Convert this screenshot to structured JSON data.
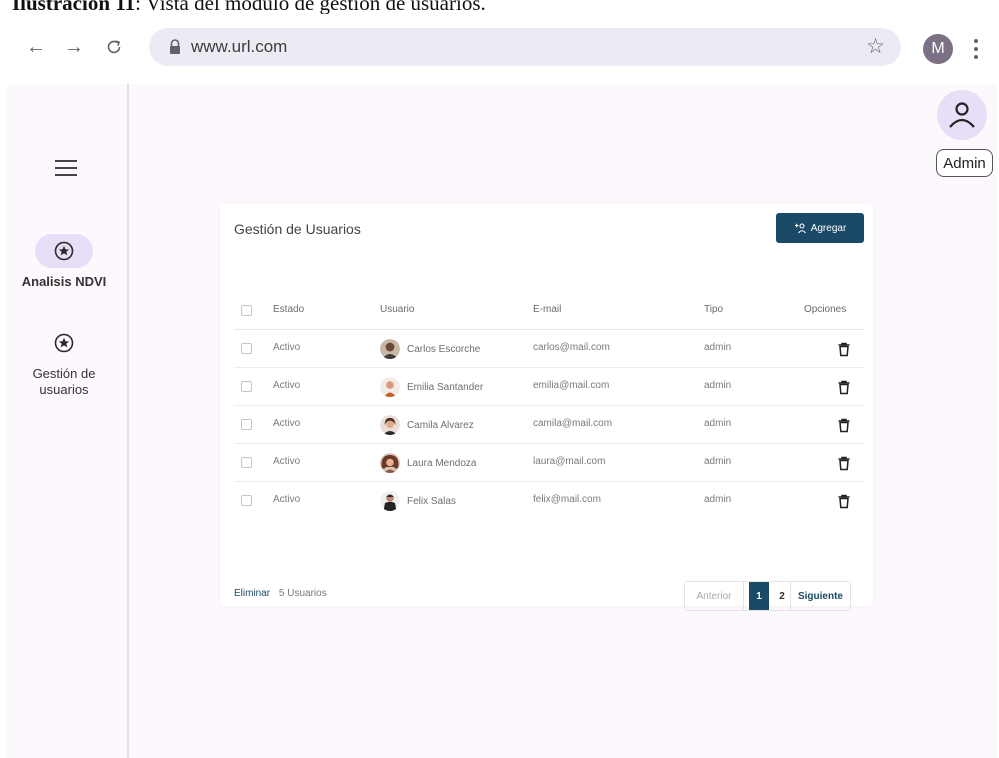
{
  "caption": {
    "label": "Ilustración 11",
    "text": ": Vista del módulo de gestión de usuarios."
  },
  "browser": {
    "url": "www.url.com",
    "profile_initial": "M"
  },
  "nav": {
    "items": [
      {
        "label": "Analisis NDVI",
        "icon": "star-circle-icon",
        "active": true
      },
      {
        "label": "Gestión de usuarios",
        "icon": "star-circle-icon",
        "active": false
      }
    ]
  },
  "user": {
    "role": "Admin"
  },
  "panel": {
    "title": "Gestión de Usuarios",
    "add_label": "Agregar",
    "columns": [
      "Estado",
      "Usuario",
      "E-mail",
      "Tipo",
      "Opciones"
    ],
    "rows": [
      {
        "estado": "Activo",
        "usuario": "Carlos Escorche",
        "email": "carlos@mail.com",
        "tipo": "admin"
      },
      {
        "estado": "Activo",
        "usuario": "Emilia Santander",
        "email": "emilia@mail.com",
        "tipo": "admin"
      },
      {
        "estado": "Activo",
        "usuario": "Camila Alvarez",
        "email": "camila@mail.com",
        "tipo": "admin"
      },
      {
        "estado": "Activo",
        "usuario": "Laura Mendoza",
        "email": "laura@mail.com",
        "tipo": "admin"
      },
      {
        "estado": "Activo",
        "usuario": "Felix Salas",
        "email": "felix@mail.com",
        "tipo": "admin"
      }
    ],
    "delete_label": "Eliminar",
    "count_label": "5 Usuarios",
    "pagination": {
      "prev": "Anterior",
      "pages": [
        "1",
        "2"
      ],
      "current": "1",
      "next": "Siguiente"
    }
  },
  "colors": {
    "primary": "#1a4a66",
    "rail_active": "#e7dff8",
    "background": "#fdf8fd"
  }
}
